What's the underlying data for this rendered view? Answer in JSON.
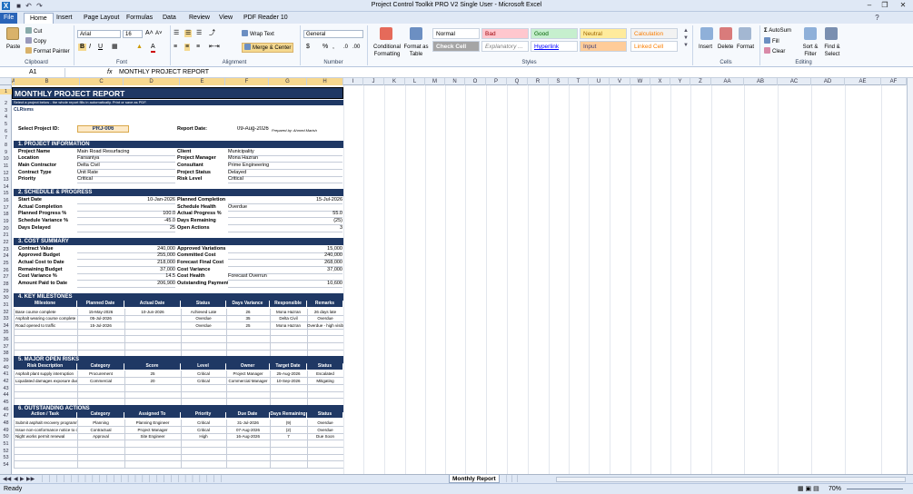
{
  "window": {
    "title": "Project Control Toolkit PRO V2 Single User - Microsoft Excel"
  },
  "menu_tabs": [
    "File",
    "Home",
    "Insert",
    "Page Layout",
    "Formulas",
    "Data",
    "Review",
    "View",
    "PDF Reader 10"
  ],
  "ribbon": {
    "clipboard": {
      "paste": "Paste",
      "cut": "Cut",
      "copy": "Copy",
      "format_painter": "Format Painter",
      "group": "Clipboard"
    },
    "font": {
      "name": "Arial",
      "size": "16",
      "group": "Font"
    },
    "alignment": {
      "wrap": "Wrap Text",
      "merge": "Merge & Center",
      "group": "Alignment"
    },
    "number": {
      "format": "General",
      "group": "Number"
    },
    "styles": {
      "conditional": "Conditional Formatting",
      "format_table": "Format as Table",
      "group": "Styles",
      "gallery": [
        {
          "label": "Normal",
          "bg": "#ffffff",
          "fg": "#000000"
        },
        {
          "label": "Bad",
          "bg": "#ffc7ce",
          "fg": "#9c0006"
        },
        {
          "label": "Good",
          "bg": "#c6efce",
          "fg": "#006100"
        },
        {
          "label": "Neutral",
          "bg": "#ffeb9c",
          "fg": "#9c6500"
        },
        {
          "label": "Calculation",
          "bg": "#f2f2f2",
          "fg": "#fa7d00"
        },
        {
          "label": "Check Cell",
          "bg": "#a5a5a5",
          "fg": "#ffffff"
        },
        {
          "label": "Explanatory ...",
          "bg": "#ffffff",
          "fg": "#7f7f7f"
        },
        {
          "label": "Hyperlink",
          "bg": "#ffffff",
          "fg": "#0000ff"
        },
        {
          "label": "Input",
          "bg": "#ffcc99",
          "fg": "#3f3f76"
        },
        {
          "label": "Linked Cell",
          "bg": "#ffffff",
          "fg": "#fa7d00"
        }
      ]
    },
    "cells": {
      "insert": "Insert",
      "delete": "Delete",
      "format": "Format",
      "group": "Cells"
    },
    "editing": {
      "autosum": "AutoSum",
      "fill": "Fill",
      "clear": "Clear",
      "sort": "Sort & Filter",
      "find": "Find & Select",
      "group": "Editing"
    }
  },
  "formula_bar": {
    "name_box": "A1",
    "fx": "fx",
    "value": "MONTHLY PROJECT REPORT"
  },
  "columns": [
    "A",
    "B",
    "C",
    "D",
    "E",
    "F",
    "G",
    "H",
    "I",
    "J",
    "K",
    "L",
    "M",
    "N",
    "O",
    "P",
    "Q",
    "R",
    "S",
    "T",
    "U",
    "V",
    "W",
    "X",
    "Y",
    "Z",
    "AA",
    "AB",
    "AC",
    "AD",
    "AE",
    "AF"
  ],
  "rows": [
    "1",
    "2",
    "3",
    "4",
    "5",
    "6",
    "7",
    "8",
    "9",
    "10",
    "11",
    "12",
    "13",
    "14",
    "15",
    "16",
    "17",
    "18",
    "19",
    "20",
    "21",
    "22",
    "23",
    "24",
    "25",
    "26",
    "27",
    "28",
    "29",
    "30",
    "31",
    "32",
    "33",
    "34",
    "35",
    "36",
    "37",
    "38",
    "39",
    "40",
    "41",
    "42",
    "43",
    "44",
    "45",
    "46",
    "47",
    "48",
    "49",
    "50",
    "51",
    "52",
    "53",
    "54"
  ],
  "report": {
    "title": "MONTHLY PROJECT REPORT",
    "subtitle": "Select a project below - the whole report fills in automatically. Print or save as PDF.",
    "logo": "CLRtems",
    "select_label": "Select Project ID:",
    "project_id": "PRJ-006",
    "report_date_label": "Report Date:",
    "report_date": "09-Aug-2026",
    "prepared_by": "Prepared by: Ahmed Martsh",
    "s1": "1.  PROJECT INFORMATION",
    "info": [
      [
        "Project Name",
        "Main Road Resurfacing",
        "Client",
        "Municipality"
      ],
      [
        "Location",
        "Farsaniya",
        "Project Manager",
        "Mona Hazran"
      ],
      [
        "Main Contractor",
        "Delta Civil",
        "Consultant",
        "Prime Engineering"
      ],
      [
        "Contract Type",
        "Unit Rate",
        "Project Status",
        "Delayed"
      ],
      [
        "Priority",
        "Critical",
        "Risk Level",
        "Critical"
      ]
    ],
    "s2": "2.  SCHEDULE & PROGRESS",
    "sched": [
      [
        "Start Date",
        "10-Jan-2026",
        "Planned Completion",
        "15-Jul-2026"
      ],
      [
        "Actual Completion",
        "",
        "Schedule Health",
        "Overdue"
      ],
      [
        "Planned Progress %",
        "100.0",
        "Actual Progress %",
        "55.0"
      ],
      [
        "Schedule Variance %",
        "-45.0",
        "Days Remaining",
        "(25)"
      ],
      [
        "Days Delayed",
        "25",
        "Open Actions",
        "3"
      ]
    ],
    "s3": "3.  COST SUMMARY",
    "cost": [
      [
        "Contract Value",
        "240,000",
        "Approved Variations",
        "15,000"
      ],
      [
        "Approved Budget",
        "255,000",
        "Committed Cost",
        "240,000"
      ],
      [
        "Actual Cost to Date",
        "218,000",
        "Forecast Final Cost",
        "268,000"
      ],
      [
        "Remaining Budget",
        "37,000",
        "Cost Variance",
        "37,000"
      ],
      [
        "Cost Variance %",
        "14.5",
        "Cost Health",
        "Forecast Overrun"
      ],
      [
        "Amount Paid to Date",
        "206,900",
        "Outstanding Payment",
        "10,600"
      ]
    ],
    "s4": "4.  KEY MILESTONES",
    "ms_head": [
      "Milestone",
      "Planned Date",
      "Actual Date",
      "Status",
      "Days Variance",
      "Responsible",
      "Remarks"
    ],
    "ms": [
      [
        "Base course complete",
        "15-May-2026",
        "10-Jun-2026",
        "Achieved Late",
        "26",
        "Mona Hazran",
        "26 days late"
      ],
      [
        "Asphalt wearing course complete",
        "05-Jul-2026",
        "",
        "Overdue",
        "35",
        "Delta Civil",
        "Overdue"
      ],
      [
        "Road opened to traffic",
        "15-Jul-2026",
        "",
        "Overdue",
        "25",
        "Mona Hazran",
        "Overdue - high visibility"
      ]
    ],
    "s5": "5.  MAJOR OPEN RISKS",
    "rk_head": [
      "Risk Description",
      "Category",
      "Score",
      "Level",
      "Owner",
      "Target Date",
      "Status"
    ],
    "rk": [
      [
        "Asphalt plant supply interruption",
        "Procurement",
        "25",
        "Critical",
        "Project Manager",
        "25-Aug-2026",
        "Escalated"
      ],
      [
        "Liquidated damages exposure due",
        "Commercial",
        "20",
        "Critical",
        "Commercial Manager",
        "10-Sep-2026",
        "Mitigating"
      ]
    ],
    "s6": "6.  OUTSTANDING ACTIONS",
    "ac_head": [
      "Action / Task",
      "Category",
      "Assigned To",
      "Priority",
      "Due Date",
      "Days Remaining",
      "Status"
    ],
    "ac": [
      [
        "Submit asphalt recovery programme",
        "Planning",
        "Planning Engineer",
        "Critical",
        "31-Jul-2026",
        "(9)",
        "Overdue"
      ],
      [
        "Issue non-conformance notice to contractor",
        "Contractual",
        "Project Manager",
        "Critical",
        "07-Aug-2026",
        "(2)",
        "Overdue"
      ],
      [
        "Night works permit renewal",
        "Approval",
        "Site Engineer",
        "High",
        "16-Aug-2026",
        "7",
        "Due Soon"
      ]
    ]
  },
  "sheet_tabs": [
    "Monthly Report"
  ],
  "status": {
    "ready": "Ready",
    "zoom": "70%"
  }
}
